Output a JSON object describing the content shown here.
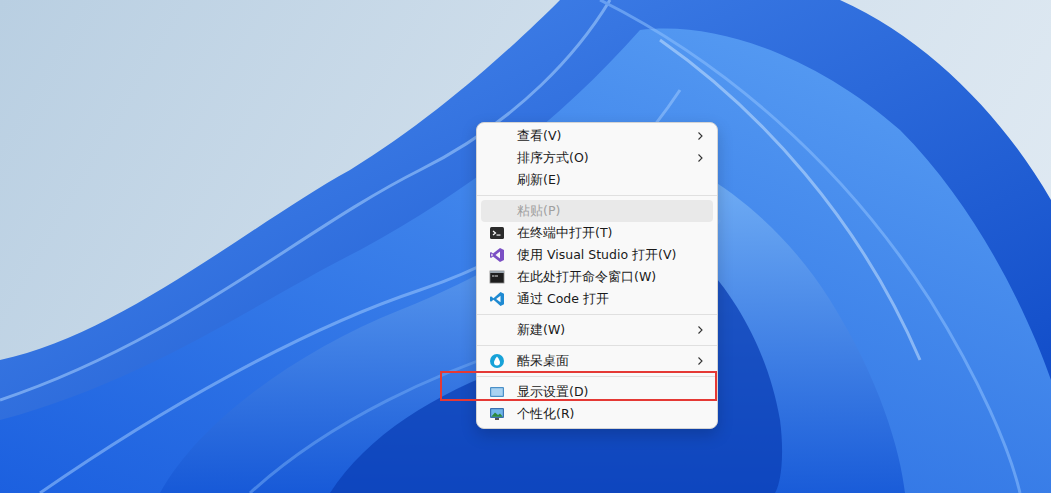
{
  "menu": {
    "items": [
      {
        "kind": "item",
        "label": "查看(V)",
        "submenu": true,
        "disabled": false,
        "selected": false,
        "annotated": false
      },
      {
        "kind": "item",
        "label": "排序方式(O)",
        "submenu": true,
        "disabled": false,
        "selected": false,
        "annotated": false
      },
      {
        "kind": "item",
        "label": "刷新(E)",
        "submenu": false,
        "disabled": false,
        "selected": false,
        "annotated": false
      },
      {
        "kind": "separator"
      },
      {
        "kind": "item",
        "label": "粘贴(P)",
        "submenu": false,
        "disabled": true,
        "selected": true,
        "annotated": false
      },
      {
        "kind": "item",
        "label": "在终端中打开(T)",
        "submenu": false,
        "disabled": false,
        "selected": false,
        "annotated": false
      },
      {
        "kind": "item",
        "label": "使用 Visual Studio 打开(V)",
        "submenu": false,
        "disabled": false,
        "selected": false,
        "annotated": false
      },
      {
        "kind": "item",
        "label": "在此处打开命令窗口(W)",
        "submenu": false,
        "disabled": false,
        "selected": false,
        "annotated": false
      },
      {
        "kind": "item",
        "label": "通过 Code 打开",
        "submenu": false,
        "disabled": false,
        "selected": false,
        "annotated": false
      },
      {
        "kind": "separator"
      },
      {
        "kind": "item",
        "label": "新建(W)",
        "submenu": true,
        "disabled": false,
        "selected": false,
        "annotated": false
      },
      {
        "kind": "separator"
      },
      {
        "kind": "item",
        "label": "酷呆桌面",
        "submenu": true,
        "disabled": false,
        "selected": false,
        "annotated": false
      },
      {
        "kind": "separator"
      },
      {
        "kind": "item",
        "label": "显示设置(D)",
        "submenu": false,
        "disabled": false,
        "selected": false,
        "annotated": true
      },
      {
        "kind": "item",
        "label": "个性化(R)",
        "submenu": false,
        "disabled": false,
        "selected": false,
        "annotated": false
      }
    ]
  }
}
